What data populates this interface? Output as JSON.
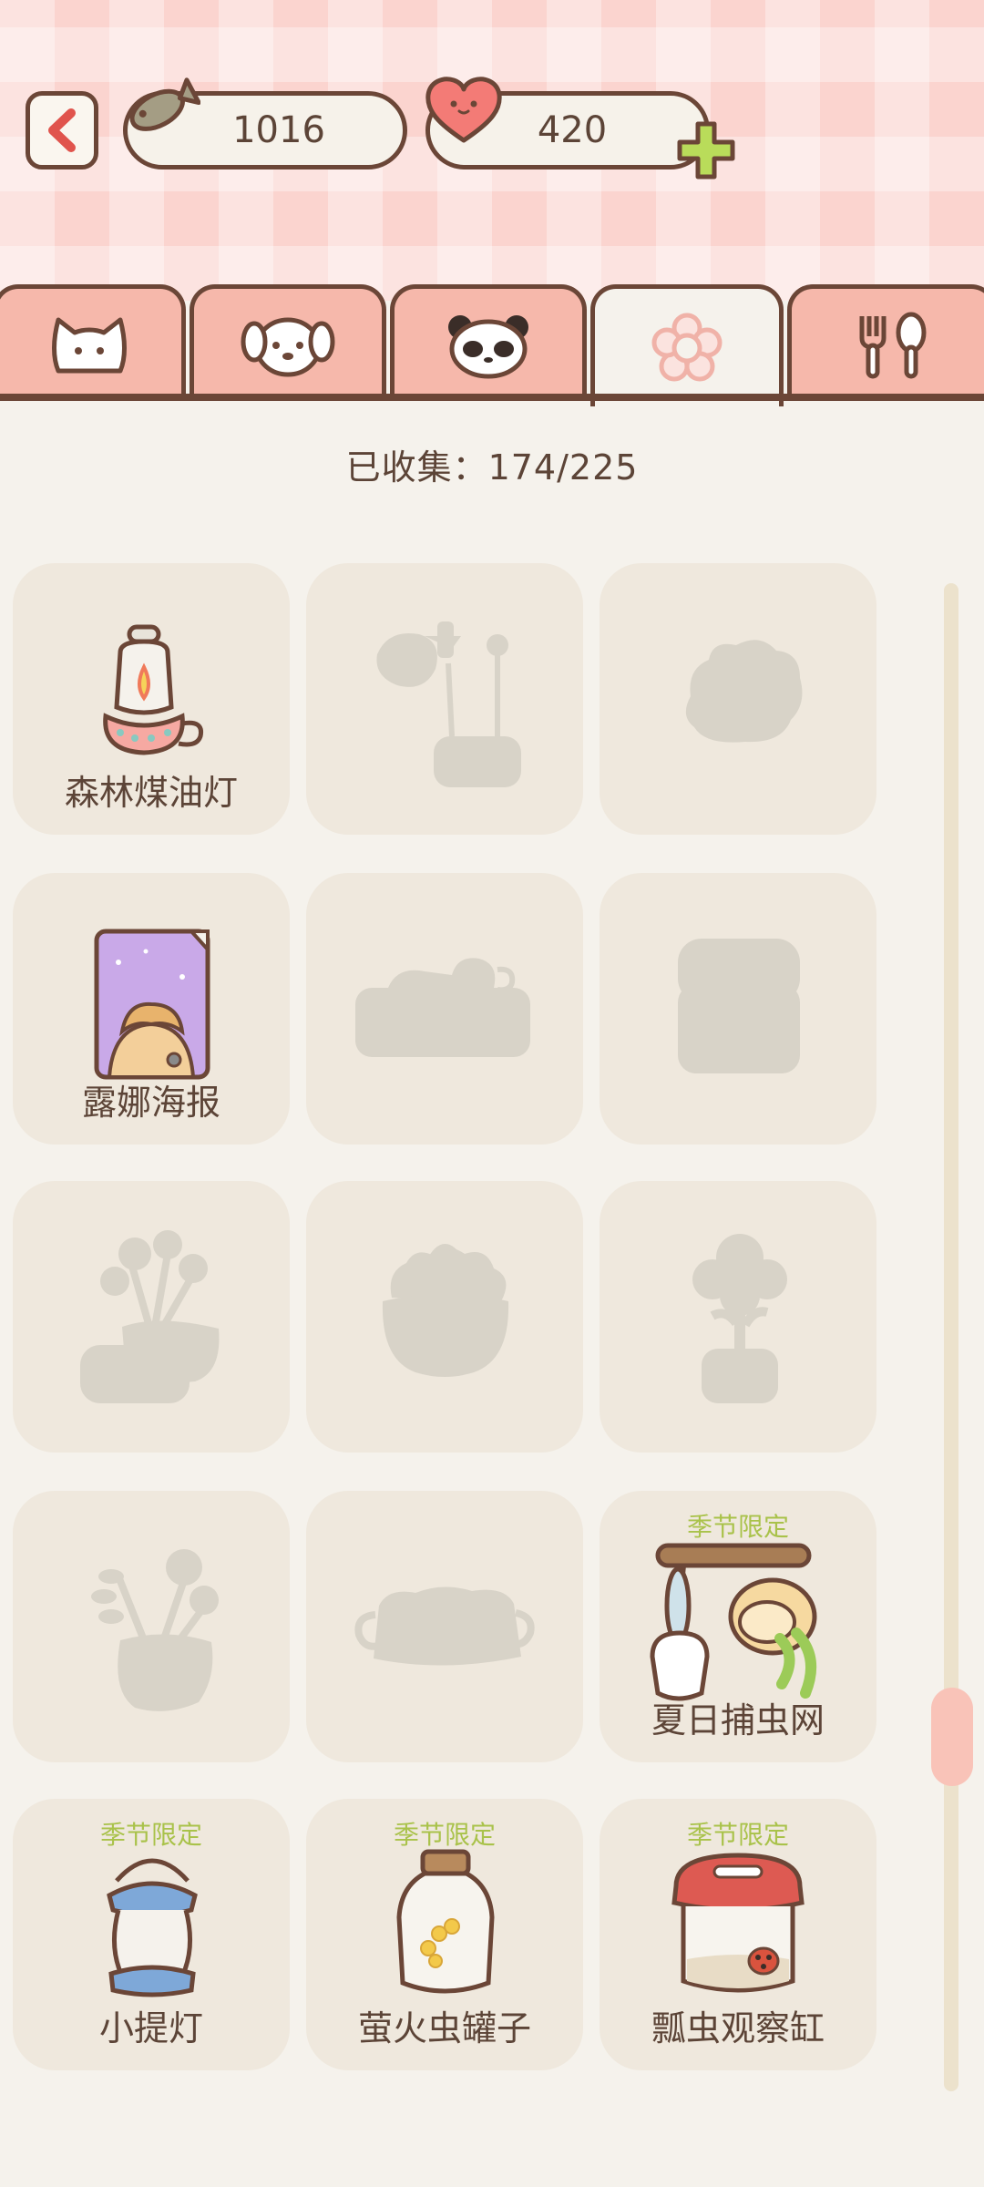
{
  "currency": {
    "fish_amount": "1016",
    "heart_amount": "420"
  },
  "tabs": [
    {
      "icon": "cat-icon",
      "active": false
    },
    {
      "icon": "dog-icon",
      "active": false
    },
    {
      "icon": "panda-icon",
      "active": false
    },
    {
      "icon": "flower-icon",
      "active": true
    },
    {
      "icon": "fork-spoon-icon",
      "active": false
    }
  ],
  "collection": {
    "collected_text": "已收集：174/225"
  },
  "items": [
    {
      "name": "森林煤油灯",
      "tag": "",
      "unlocked": true,
      "icon": "oil-lamp-icon"
    },
    {
      "name": "",
      "tag": "",
      "unlocked": false,
      "icon": "locked-silhouette-icon"
    },
    {
      "name": "",
      "tag": "",
      "unlocked": false,
      "icon": "locked-silhouette-icon"
    },
    {
      "name": "露娜海报",
      "tag": "",
      "unlocked": true,
      "icon": "poster-icon"
    },
    {
      "name": "",
      "tag": "",
      "unlocked": false,
      "icon": "locked-silhouette-icon"
    },
    {
      "name": "",
      "tag": "",
      "unlocked": false,
      "icon": "locked-silhouette-icon"
    },
    {
      "name": "",
      "tag": "",
      "unlocked": false,
      "icon": "locked-silhouette-icon"
    },
    {
      "name": "",
      "tag": "",
      "unlocked": false,
      "icon": "locked-silhouette-icon"
    },
    {
      "name": "",
      "tag": "",
      "unlocked": false,
      "icon": "locked-silhouette-icon"
    },
    {
      "name": "",
      "tag": "",
      "unlocked": false,
      "icon": "locked-silhouette-icon"
    },
    {
      "name": "",
      "tag": "",
      "unlocked": false,
      "icon": "locked-silhouette-icon"
    },
    {
      "name": "夏日捕虫网",
      "tag": "季节限定",
      "unlocked": true,
      "icon": "bug-net-icon"
    },
    {
      "name": "小提灯",
      "tag": "季节限定",
      "unlocked": true,
      "icon": "lantern-icon"
    },
    {
      "name": "萤火虫罐子",
      "tag": "季节限定",
      "unlocked": true,
      "icon": "firefly-jar-icon"
    },
    {
      "name": "瓢虫观察缸",
      "tag": "季节限定",
      "unlocked": true,
      "icon": "ladybug-tank-icon"
    }
  ],
  "colors": {
    "outline": "#6b4637",
    "header_pink": "#fbd4cf",
    "tab_pink": "#f6b8ab",
    "card_bg": "#efe8dd",
    "silhouette": "#d8d3c8",
    "seasonal_tag": "#a9c24a",
    "plus_green": "#b9dc5a"
  }
}
